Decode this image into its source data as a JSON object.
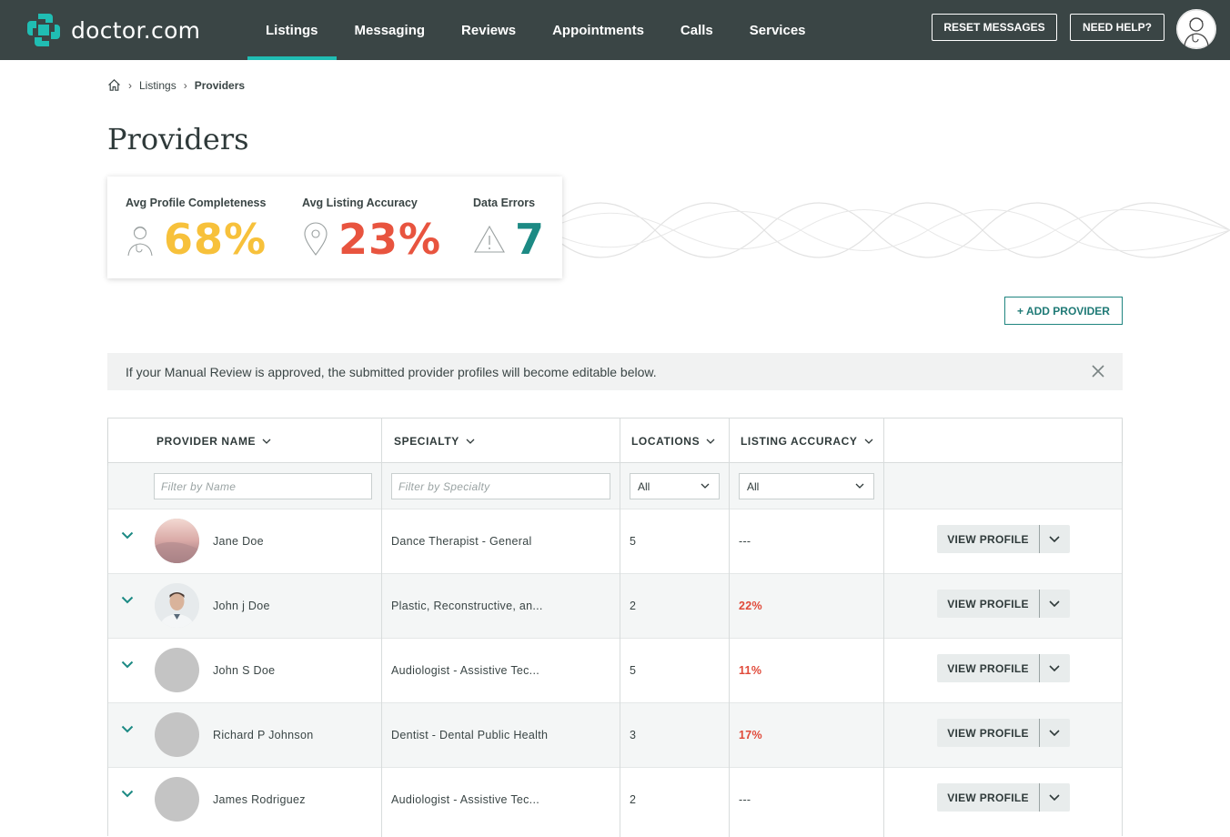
{
  "header": {
    "logo_text": "doctor.com",
    "nav": [
      {
        "label": "Listings",
        "active": true
      },
      {
        "label": "Messaging"
      },
      {
        "label": "Reviews"
      },
      {
        "label": "Appointments"
      },
      {
        "label": "Calls"
      },
      {
        "label": "Services"
      }
    ],
    "reset_messages": "RESET MESSAGES",
    "need_help": "NEED HELP?"
  },
  "breadcrumb": {
    "items": [
      "Listings",
      "Providers"
    ]
  },
  "page_title": "Providers",
  "stats": {
    "completeness": {
      "label": "Avg Profile Completeness",
      "value": "68%",
      "color": "#f7c13b"
    },
    "accuracy": {
      "label": "Avg Listing Accuracy",
      "value": "23%",
      "color": "#e8543f"
    },
    "errors": {
      "label": "Data Errors",
      "value": "7",
      "color": "#1c8a84"
    }
  },
  "add_provider": "+ ADD PROVIDER",
  "notice": {
    "text": "If your Manual Review is approved, the submitted provider profiles will become editable below."
  },
  "table": {
    "columns": [
      "PROVIDER NAME",
      "SPECIALTY",
      "LOCATIONS",
      "LISTING ACCURACY"
    ],
    "filters": {
      "name_placeholder": "Filter by Name",
      "specialty_placeholder": "Filter by Specialty",
      "locations_value": "All",
      "accuracy_value": "All"
    },
    "view_profile_label": "VIEW PROFILE",
    "rows": [
      {
        "name": "Jane Doe",
        "specialty": "Dance Therapist - General",
        "locations": "5",
        "accuracy": "---"
      },
      {
        "name": "John j Doe",
        "specialty": "Plastic, Reconstructive, an...",
        "locations": "2",
        "accuracy": "22%"
      },
      {
        "name": "John S Doe",
        "specialty": "Audiologist - Assistive Tec...",
        "locations": "5",
        "accuracy": "11%"
      },
      {
        "name": "Richard P Johnson",
        "specialty": "Dentist - Dental Public Health",
        "locations": "3",
        "accuracy": "17%"
      },
      {
        "name": "James Rodriguez",
        "specialty": "Audiologist - Assistive Tec...",
        "locations": "2",
        "accuracy": "---"
      }
    ]
  }
}
